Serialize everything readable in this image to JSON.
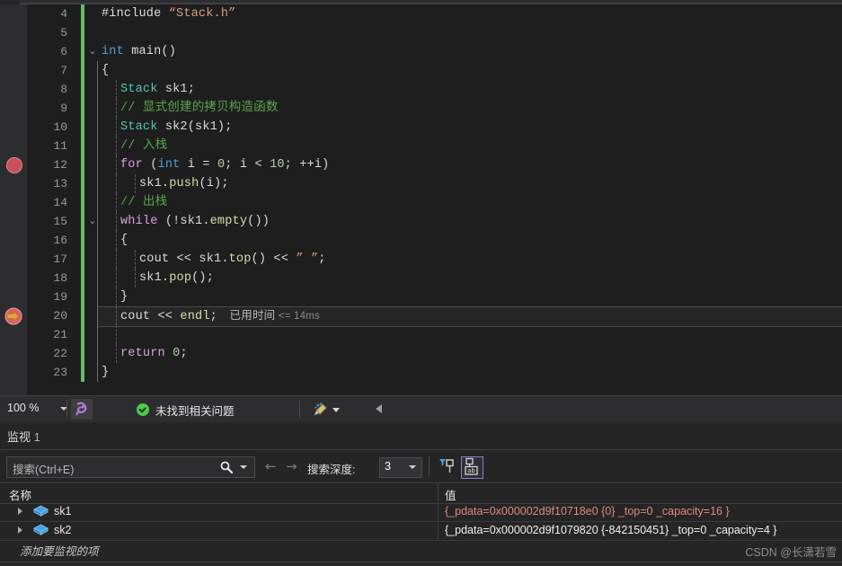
{
  "editor": {
    "zoom_level": "100 %",
    "lines": [
      {
        "no": "4",
        "indent": 0,
        "tokens": [
          {
            "t": "#include ",
            "c": "plain"
          },
          {
            "t": "“Stack.h”",
            "c": "str"
          }
        ]
      },
      {
        "no": "5",
        "indent": 0,
        "tokens": []
      },
      {
        "no": "6",
        "indent": 0,
        "fold": "⌄",
        "tokens": [
          {
            "t": "int",
            "c": "kw"
          },
          {
            "t": " main()",
            "c": "plain"
          }
        ]
      },
      {
        "no": "7",
        "indent": 1,
        "tokens": [
          {
            "t": "{",
            "c": "plain"
          }
        ]
      },
      {
        "no": "8",
        "indent": 2,
        "tokens": [
          {
            "t": "Stack",
            "c": "cls"
          },
          {
            "t": " sk1;",
            "c": "plain"
          }
        ]
      },
      {
        "no": "9",
        "indent": 2,
        "tokens": [
          {
            "t": "// 显式创建的拷贝构造函数",
            "c": "cmt"
          }
        ]
      },
      {
        "no": "10",
        "indent": 2,
        "tokens": [
          {
            "t": "Stack",
            "c": "cls"
          },
          {
            "t": " sk2(sk1);",
            "c": "plain"
          }
        ]
      },
      {
        "no": "11",
        "indent": 2,
        "tokens": [
          {
            "t": "// 入栈",
            "c": "cmt"
          }
        ]
      },
      {
        "no": "12",
        "indent": 2,
        "breakpoint": true,
        "tokens": [
          {
            "t": "for",
            "c": "kwm"
          },
          {
            "t": " (",
            "c": "plain"
          },
          {
            "t": "int",
            "c": "kw"
          },
          {
            "t": " i = ",
            "c": "plain"
          },
          {
            "t": "0",
            "c": "num"
          },
          {
            "t": "; i < ",
            "c": "plain"
          },
          {
            "t": "10",
            "c": "num"
          },
          {
            "t": "; ++i)",
            "c": "plain"
          }
        ]
      },
      {
        "no": "13",
        "indent": 3,
        "tokens": [
          {
            "t": "sk1.",
            "c": "plain"
          },
          {
            "t": "push",
            "c": "fn"
          },
          {
            "t": "(i);",
            "c": "plain"
          }
        ]
      },
      {
        "no": "14",
        "indent": 2,
        "tokens": [
          {
            "t": "// 出栈",
            "c": "cmt"
          }
        ]
      },
      {
        "no": "15",
        "indent": 2,
        "fold": "⌄",
        "tokens": [
          {
            "t": "while",
            "c": "kwm"
          },
          {
            "t": " (!sk1.",
            "c": "plain"
          },
          {
            "t": "empty",
            "c": "fn"
          },
          {
            "t": "())",
            "c": "plain"
          }
        ]
      },
      {
        "no": "16",
        "indent": 2,
        "tokens": [
          {
            "t": "{",
            "c": "plain"
          }
        ]
      },
      {
        "no": "17",
        "indent": 3,
        "tokens": [
          {
            "t": "cout << sk1.",
            "c": "plain"
          },
          {
            "t": "top",
            "c": "fn"
          },
          {
            "t": "() << ",
            "c": "plain"
          },
          {
            "t": "” ”",
            "c": "str"
          },
          {
            "t": ";",
            "c": "plain"
          }
        ]
      },
      {
        "no": "18",
        "indent": 3,
        "tokens": [
          {
            "t": "sk1.",
            "c": "plain"
          },
          {
            "t": "pop",
            "c": "fn"
          },
          {
            "t": "();",
            "c": "plain"
          }
        ]
      },
      {
        "no": "19",
        "indent": 2,
        "tokens": [
          {
            "t": "}",
            "c": "plain"
          }
        ]
      },
      {
        "no": "20",
        "indent": 2,
        "current": true,
        "stmt_arrow": true,
        "tokens": [
          {
            "t": "cout << ",
            "c": "plain"
          },
          {
            "t": "endl",
            "c": "fn"
          },
          {
            "t": ";",
            "c": "plain"
          }
        ],
        "annotation_cn": "已用时间",
        "annotation_en": " <= 14ms"
      },
      {
        "no": "21",
        "indent": 2,
        "tokens": []
      },
      {
        "no": "22",
        "indent": 2,
        "tokens": [
          {
            "t": "return",
            "c": "kwm"
          },
          {
            "t": " ",
            "c": "plain"
          },
          {
            "t": "0",
            "c": "num"
          },
          {
            "t": ";",
            "c": "plain"
          }
        ]
      },
      {
        "no": "23",
        "indent": 1,
        "tokens": [
          {
            "t": "}",
            "c": "plain"
          }
        ]
      }
    ]
  },
  "status_bar": {
    "zoom": "100 %",
    "intellisense_icon": "intellisense-icon",
    "status_icon": "green-check-icon",
    "message": "未找到相关问题",
    "brush_icon": "brush-icon",
    "collapse_icon": "left-triangle-icon"
  },
  "watch_panel": {
    "title": "监视",
    "title_number": "1",
    "search_placeholder": "搜索(Ctrl+E)",
    "search_icon": "search-icon",
    "prev_icon": "←",
    "next_icon": "→",
    "depth_label": "搜索深度:",
    "depth_value": "3",
    "pin_icon_1": "filter-pin-icon",
    "pin_icon_2": "pin-ab-icon",
    "columns": {
      "name": "名称",
      "value": "值"
    },
    "rows": [
      {
        "name": "sk1",
        "icon": "object-cube-icon",
        "value": "{_pdata=0x000002d9f10718e0 {0} _top=0 _capacity=16 }",
        "changed": true
      },
      {
        "name": "sk2",
        "icon": "object-cube-icon",
        "value": "{_pdata=0x000002d9f1079820 {-842150451} _top=0 _capacity=4 }",
        "changed": false
      }
    ],
    "add_item_placeholder": "添加要监视的项"
  },
  "watermark": "CSDN @长潇若雪",
  "colors": {
    "background": "#1e1e1e",
    "panel": "#252526",
    "changed_value": "#e08a7a",
    "changebar": "#5fbf61",
    "breakpoint": "#c75059",
    "stmt_arrow": "#e8a33d"
  }
}
